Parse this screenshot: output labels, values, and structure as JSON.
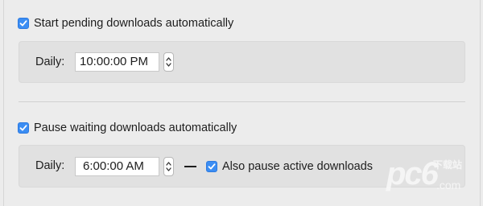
{
  "section1": {
    "checkbox_label": "Start pending downloads automatically",
    "checked": true,
    "daily_label": "Daily:",
    "time_value": "10:00:00 PM"
  },
  "section2": {
    "checkbox_label": "Pause waiting downloads automatically",
    "checked": true,
    "daily_label": "Daily:",
    "time_value": "6:00:00 AM",
    "separator": "—",
    "also_pause_label": "Also pause active downloads",
    "also_pause_checked": true
  },
  "watermark": {
    "big": "pc6",
    "small": "下载站",
    "domain": ".com"
  },
  "colors": {
    "accent": "#3b8df3",
    "background": "#ececec",
    "panel": "#e1e1e1"
  }
}
